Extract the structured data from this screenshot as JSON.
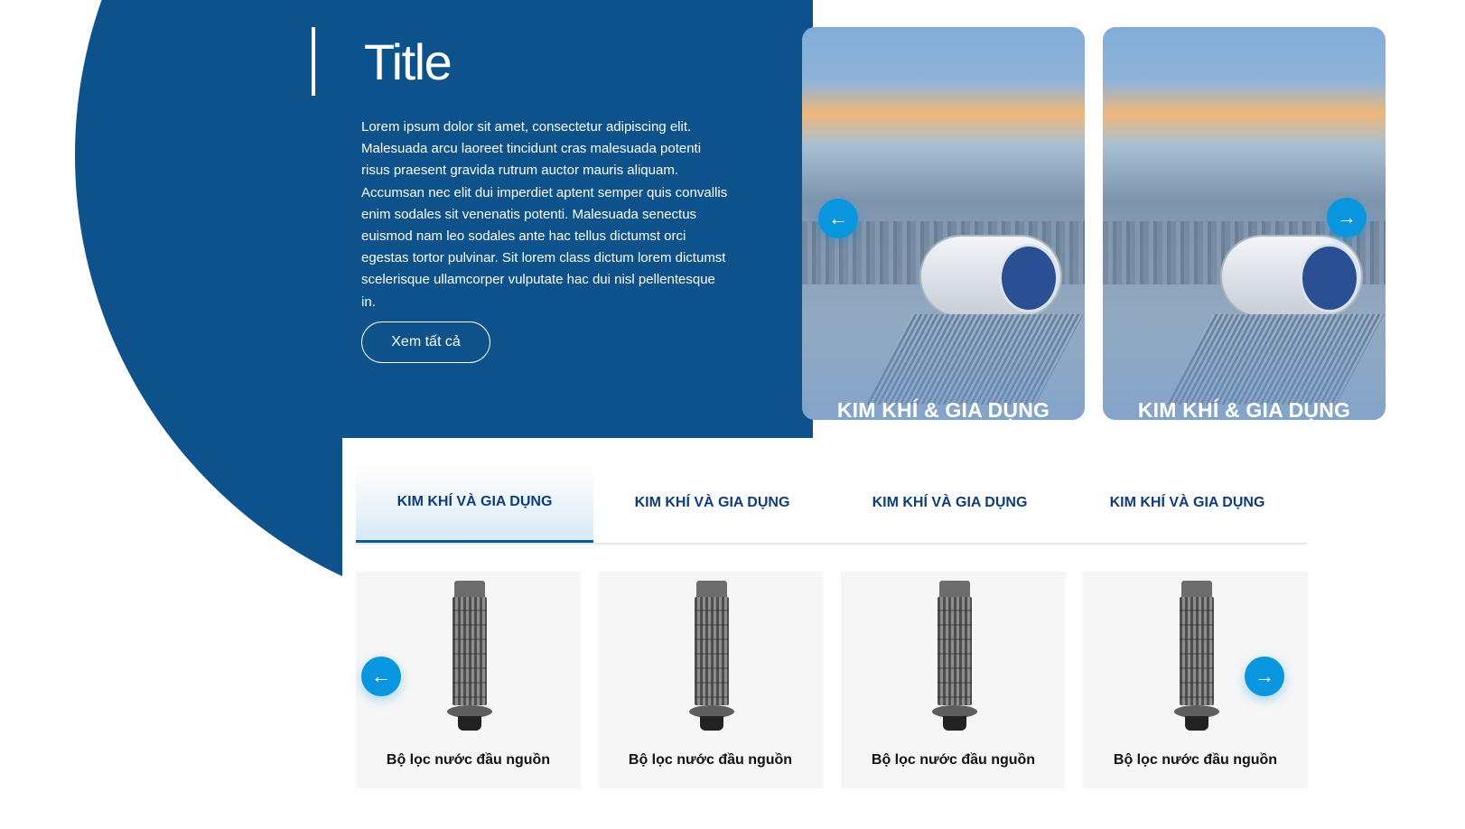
{
  "hero": {
    "title": "Title",
    "description": "Lorem ipsum dolor sit amet, consectetur adipiscing elit. Malesuada arcu laoreet tincidunt cras malesuada potenti risus praesent gravida rutrum auctor mauris aliquam. Accumsan nec elit dui imperdiet aptent semper quis convallis enim sodales sit venenatis potenti. Malesuada senectus euismod nam leo sodales ante hac tellus dictumst orci egestas tortor pulvinar. Sit lorem class dictum lorem dictumst scelerisque ullamcorper vulputate hac dui nisl pellentesque in.",
    "view_all_label": "Xem tất cả"
  },
  "category_cards": [
    {
      "label": "KIM KHÍ & GIA DỤNG"
    },
    {
      "label": "KIM KHÍ & GIA DỤNG"
    }
  ],
  "tabs": [
    {
      "label": "KIM KHÍ VÀ GIA DỤNG",
      "active": true
    },
    {
      "label": "KIM KHÍ VÀ GIA DỤNG",
      "active": false
    },
    {
      "label": "KIM KHÍ VÀ GIA DỤNG",
      "active": false
    },
    {
      "label": "KIM KHÍ VÀ GIA DỤNG",
      "active": false
    }
  ],
  "products": [
    {
      "name": "Bộ lọc nước đầu nguồn"
    },
    {
      "name": "Bộ lọc nước đầu nguồn"
    },
    {
      "name": "Bộ lọc nước đầu nguồn"
    },
    {
      "name": "Bộ lọc nước đầu nguồn"
    }
  ],
  "icons": {
    "prev": "arrow-left-icon",
    "next": "arrow-right-icon"
  },
  "colors": {
    "brand_blue": "#0d528a",
    "accent": "#0a96df",
    "tab_text": "#0d3d7a"
  }
}
